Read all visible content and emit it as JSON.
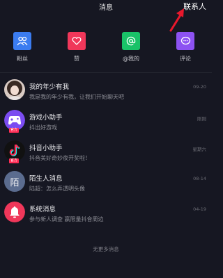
{
  "header": {
    "title": "消息",
    "contacts_label": "联系人"
  },
  "quick_actions": [
    {
      "label": "粉丝",
      "icon": "fans-icon",
      "color": "#3b7cf0"
    },
    {
      "label": "赞",
      "icon": "heart-icon",
      "color": "#f0375a"
    },
    {
      "label": "@我的",
      "icon": "at-icon",
      "color": "#19c268"
    },
    {
      "label": "评论",
      "icon": "comment-icon",
      "color": "#8d52f2"
    }
  ],
  "messages": [
    {
      "name": "我的年少有我",
      "preview": "我是我的年少有我，让我们开始聊天吧",
      "time": "09-20"
    },
    {
      "name": "游戏小助手",
      "preview": "抖出好游戏",
      "time": "刚刚",
      "badge": "官方"
    },
    {
      "name": "抖音小助手",
      "preview": "抖音美好奇妙夜开奖啦！",
      "time": "星期六",
      "badge": "官方"
    },
    {
      "name": "陌生人消息",
      "preview": "陆超：怎么弄透明头像",
      "time": "08-14",
      "avatar_char": "陌"
    },
    {
      "name": "系统消息",
      "preview": "参与新人调查 赢限量抖音周边",
      "time": "04-19"
    }
  ],
  "footer": "无更多消息",
  "colors": {
    "accent": "#fe2c55",
    "background": "#161722"
  }
}
